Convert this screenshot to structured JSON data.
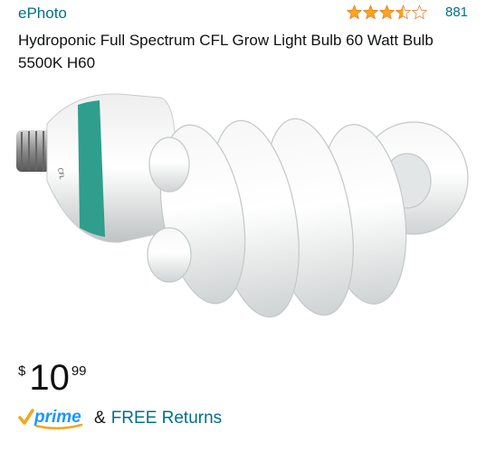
{
  "product": {
    "brand": "ePhoto",
    "rating": {
      "stars": 3.5,
      "max": 5,
      "count": "881"
    },
    "title": "Hydroponic Full Spectrum CFL Grow Light Bulb 60 Watt Bulb 5500K H60",
    "image_alt": "Spiral CFL grow light bulb",
    "price": {
      "symbol": "$",
      "whole": "10",
      "fraction": "99"
    },
    "shipping": {
      "logo_text": "prime",
      "connector": "&",
      "returns_text": "FREE Returns"
    }
  },
  "colors": {
    "link": "#007185",
    "star": "#FFA41C",
    "prime_check": "#F7A51D",
    "prime_text": "#1A98FF"
  }
}
